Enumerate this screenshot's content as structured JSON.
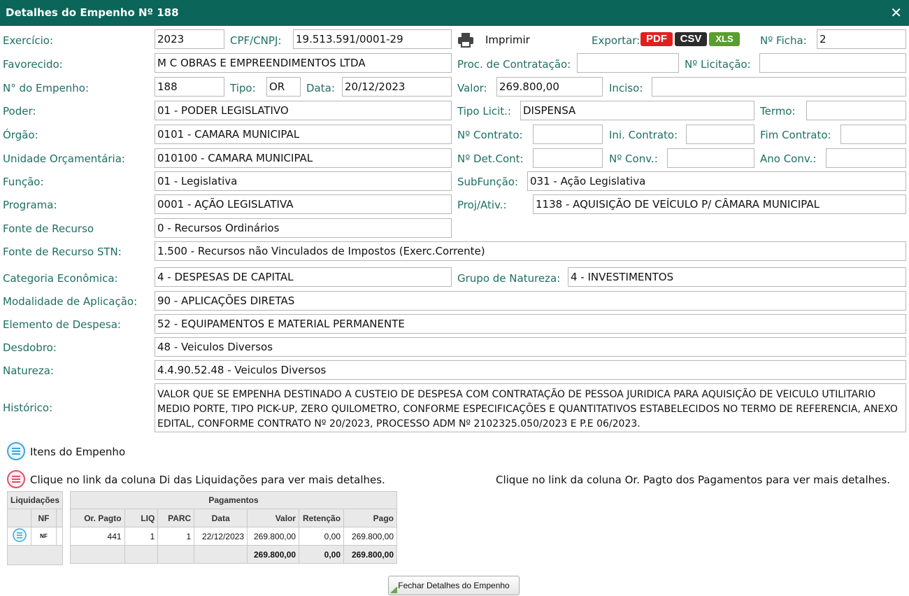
{
  "window": {
    "title": "Detalhes do Empenho Nº 188",
    "close": "✕"
  },
  "labels": {
    "exercicio": "Exercício:",
    "cpf": "CPF/CNPJ:",
    "imprimir": "Imprimir",
    "exportar": "Exportar:",
    "ficha": "Nº Ficha:",
    "favorecido": "Favorecido:",
    "proc": "Proc. de Contratação:",
    "licitacao": "Nº Licitação:",
    "empenho": "N° do Empenho:",
    "tipo": "Tipo:",
    "data": "Data:",
    "valor": "Valor:",
    "inciso": "Inciso:",
    "poder": "Poder:",
    "tipo_licit": "Tipo Licit.:",
    "termo": "Termo:",
    "orgao": "Órgão:",
    "contrato": "Nº Contrato:",
    "ini_contrato": "Ini. Contrato:",
    "fim_contrato": "Fim Contrato:",
    "unidade": "Unidade Orçamentária:",
    "det_cont": "Nº Det.Cont:",
    "conv": "Nº Conv.:",
    "ano_conv": "Ano Conv.:",
    "funcao": "Função:",
    "subfuncao": "SubFunção:",
    "programa": "Programa:",
    "proj_ativ": "Proj/Ativ.:",
    "fonte": "Fonte de Recurso",
    "fonte_stn": "Fonte de Recurso STN:",
    "categoria": "Categoria Econômica:",
    "grupo": "Grupo de Natureza:",
    "modalidade": "Modalidade de Aplicação:",
    "elemento": "Elemento de Despesa:",
    "desdobro": "Desdobro:",
    "natureza": "Natureza:",
    "historico": "Histórico:"
  },
  "values": {
    "exercicio": "2023",
    "cpf": "19.513.591/0001-29",
    "ficha": "2",
    "favorecido": "M C OBRAS E EMPREENDIMENTOS LTDA",
    "proc": "",
    "licitacao": "",
    "empenho": "188",
    "tipo": "OR",
    "data": "20/12/2023",
    "valor": "269.800,00",
    "inciso": "",
    "poder": "01 - PODER LEGISLATIVO",
    "tipo_licit": "DISPENSA",
    "termo": "",
    "orgao": "0101 - CAMARA MUNICIPAL",
    "contrato": "",
    "ini_contrato": "",
    "fim_contrato": "",
    "unidade": "010100 - CAMARA MUNICIPAL",
    "det_cont": "",
    "conv": "",
    "ano_conv": "",
    "funcao": "01 - Legislativa",
    "subfuncao": "031 - Ação Legislativa",
    "programa": "0001 - AÇÃO LEGISLATIVA",
    "proj_ativ": "1138 - AQUISIÇÃO DE VEÍCULO P/ CÂMARA MUNICIPAL",
    "fonte": "0 - Recursos Ordinários",
    "fonte_stn": "1.500 - Recursos não Vinculados de Impostos (Exerc.Corrente)",
    "categoria": "4 - DESPESAS DE CAPITAL",
    "grupo": "4 - INVESTIMENTOS",
    "modalidade": "90 - APLICAÇÕES DIRETAS",
    "elemento": "52 - EQUIPAMENTOS E MATERIAL PERMANENTE",
    "desdobro": "48 - Veiculos Diversos",
    "natureza": "4.4.90.52.48 - Veiculos Diversos",
    "historico": "VALOR QUE SE EMPENHA DESTINADO A CUSTEIO DE DESPESA COM CONTRATAÇÃO DE PESSOA JURIDICA PARA AQUISIÇÃO DE VEICULO UTILITARIO MEDIO PORTE, TIPO PICK-UP, ZERO QUILOMETRO, CONFORME ESPECIFICAÇÕES E QUANTITATIVOS ESTABELECIDOS NO TERMO DE REFERENCIA, ANEXO EDITAL, CONFORME CONTRATO Nº 20/2023, PROCESSO ADM Nº 2102325.050/2023 E P.E 06/2023."
  },
  "export": {
    "pdf": "PDF",
    "csv": "CSV",
    "xls": "XLS",
    "pdf_color": "#e02020",
    "csv_color": "#2b2b2b",
    "xls_color": "#5a9e2f"
  },
  "sections": {
    "itens": "Itens do Empenho",
    "liq_hint": "Clique no link da coluna Di das Liquidações para ver mais detalhes.",
    "pag_hint": "Clique no link da coluna Or. Pagto dos Pagamentos para ver mais detalhes."
  },
  "liquidacoes": {
    "title": "Liquidações",
    "col_nf": "NF",
    "nf_icon": "NF"
  },
  "pagamentos": {
    "title": "Pagamentos",
    "columns": [
      "Or. Pagto",
      "LIQ",
      "PARC",
      "Data",
      "Valor",
      "Retenção",
      "Pago"
    ],
    "rows": [
      [
        "441",
        "1",
        "1",
        "22/12/2023",
        "269.800,00",
        "0,00",
        "269.800,00"
      ]
    ],
    "totals": [
      "",
      "",
      "",
      "",
      "269.800,00",
      "0,00",
      "269.800,00"
    ]
  },
  "footer": {
    "close_button": "Fechar Detalhes do Empenho"
  },
  "colors": {
    "header": "#0b6559",
    "label": "#1e6f64"
  }
}
